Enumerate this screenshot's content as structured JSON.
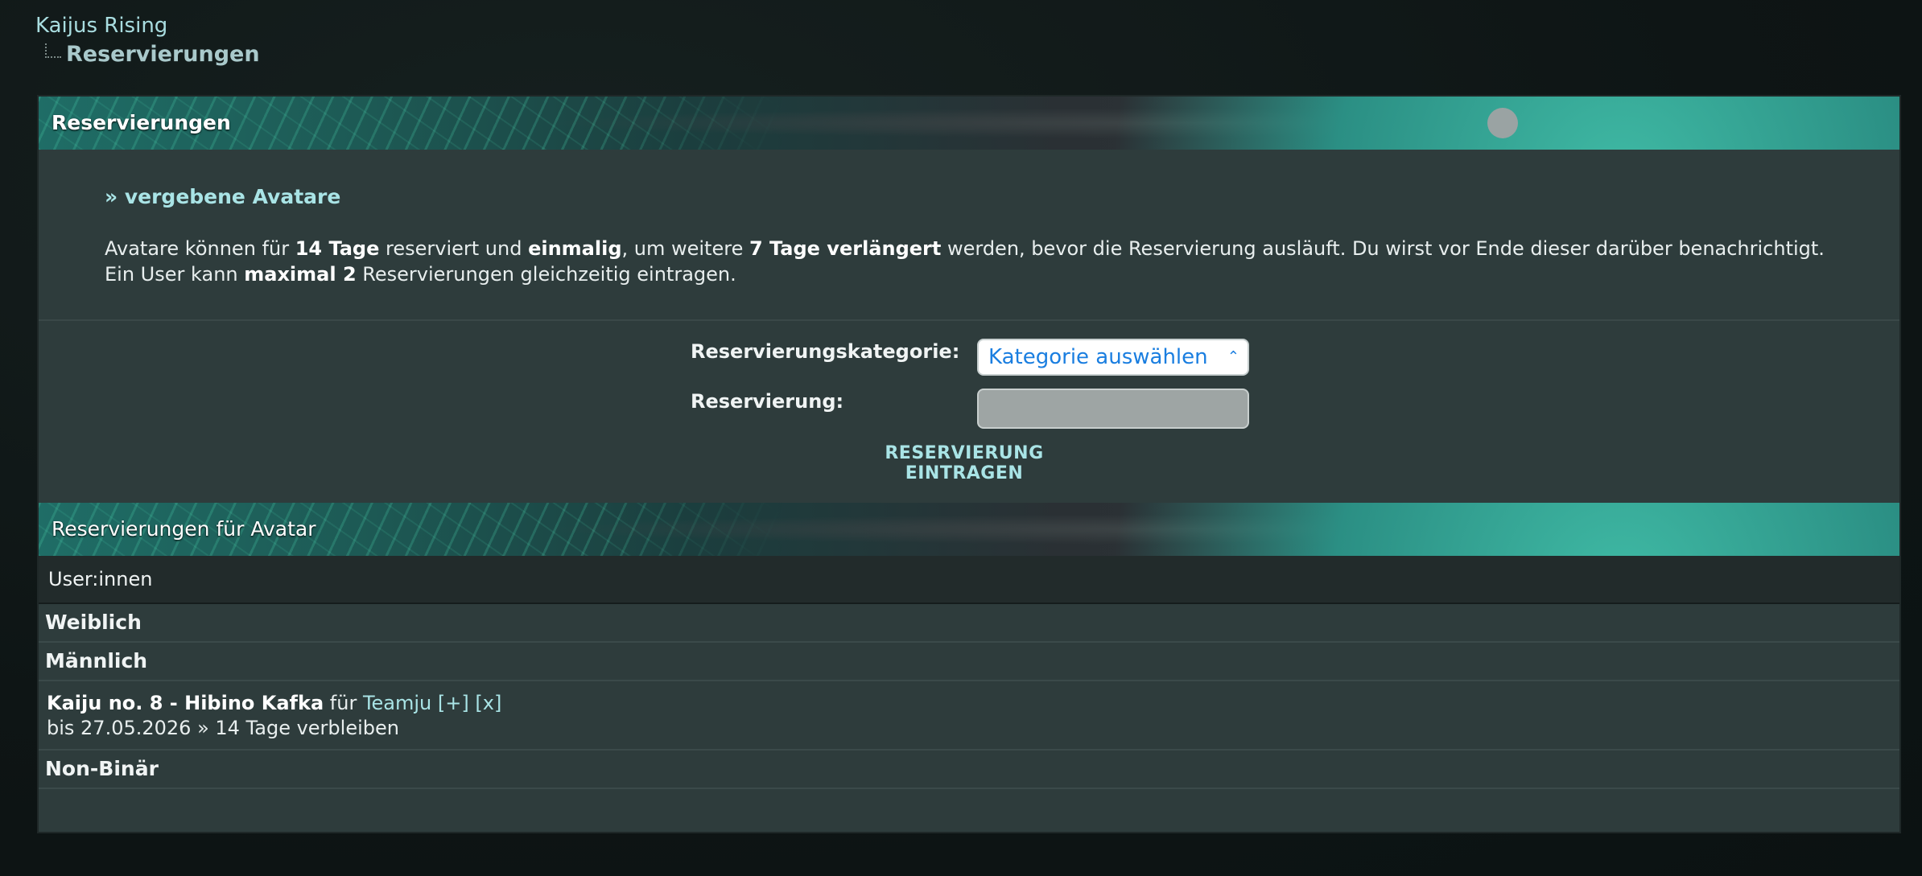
{
  "breadcrumb": {
    "root": "Kaijus Rising",
    "current": "Reservierungen"
  },
  "section1": {
    "title": "Reservierungen"
  },
  "info": {
    "link": "» vergebene Avatare",
    "text_a": "Avatare können für ",
    "days": "14 Tage",
    "text_b": " reserviert und ",
    "once": "einmalig",
    "text_c": ", um weitere ",
    "extend": "7 Tage verlängert",
    "text_d": " werden, bevor die Reservierung ausläuft. Du wirst vor Ende dieser darüber benachrichtigt.",
    "text_e": "Ein User kann ",
    "max": "maximal 2",
    "text_f": " Reservierungen gleichzeitig eintragen."
  },
  "form": {
    "category_label": "Reservierungskategorie:",
    "category_selected": "Kategorie auswählen",
    "reservation_label": "Reservierung:",
    "reservation_value": "",
    "submit_label": "RESERVIERUNG EINTRAGEN"
  },
  "section2": {
    "title": "Reservierungen für Avatar",
    "column_header": "User:innen"
  },
  "groups": [
    {
      "label": "Weiblich"
    },
    {
      "label": "Männlich"
    },
    {
      "label": "Non-Binär"
    }
  ],
  "entries": [
    {
      "avatar": "Kaiju no. 8 - Hibino Kafka",
      "for_word": " für ",
      "user": "Teamju",
      "extend_link": "[+]",
      "delete_link": "[x]",
      "expiry": "bis 27.05.2026 » 14 Tage verbleiben"
    }
  ],
  "icons": {
    "select_arrow": "chevron-up-down-icon"
  },
  "colors": {
    "accent": "#a9e4e6",
    "panel": "#2e3c3c",
    "select_text": "#1a7ee0"
  }
}
